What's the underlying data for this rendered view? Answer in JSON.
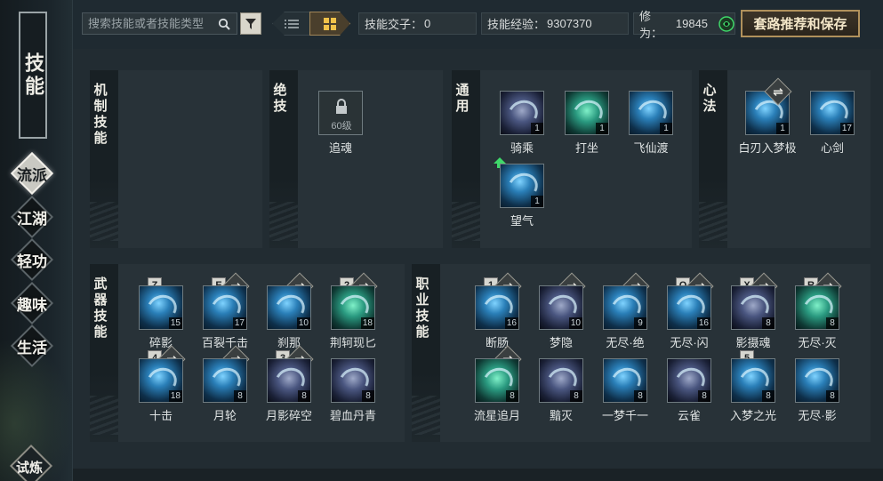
{
  "sidebar": {
    "title": "技能",
    "items": [
      {
        "label": "流派",
        "active": true
      },
      {
        "label": "江湖",
        "active": false
      },
      {
        "label": "轻功",
        "active": false
      },
      {
        "label": "趣味",
        "active": false
      },
      {
        "label": "生活",
        "active": false
      }
    ],
    "trial_label": "试炼"
  },
  "toolbar": {
    "search_placeholder": "搜索技能或者技能类型",
    "search_icon": "search-icon",
    "filter_icon": "filter-icon",
    "view_modes": [
      "list",
      "grid"
    ],
    "active_view": "grid",
    "stats": [
      {
        "label": "技能交子：",
        "value": "0"
      },
      {
        "label": "技能经验：",
        "value": "9307370"
      },
      {
        "label": "修为：",
        "value": "19845"
      }
    ],
    "recommend_label": "套路推荐和保存"
  },
  "panels": {
    "mechanism": {
      "title": "机制技能"
    },
    "ultimate": {
      "title": "绝技",
      "skills": [
        {
          "name": "追魂",
          "locked": true,
          "lock_text": "60级"
        }
      ]
    },
    "general": {
      "title": "通用",
      "skills": [
        {
          "name": "骑乘",
          "level": "1"
        },
        {
          "name": "打坐",
          "level": "1"
        },
        {
          "name": "飞仙渡",
          "level": "1"
        },
        {
          "name": "望气",
          "level": "1",
          "upgrade": true
        }
      ]
    },
    "mind": {
      "title": "心法",
      "skills": [
        {
          "name": "白刃入梦极",
          "level": "1",
          "swap": true
        },
        {
          "name": "心剑",
          "level": "17"
        }
      ]
    },
    "weapon": {
      "title": "武器技能",
      "skills": [
        {
          "name": "碎影",
          "level": "15",
          "key": "Z"
        },
        {
          "name": "百裂千击",
          "level": "17",
          "key": "E",
          "swap": true
        },
        {
          "name": "刹那",
          "level": "10",
          "swap": true
        },
        {
          "name": "荆轲现匕",
          "level": "18",
          "key": "2",
          "swap": true
        },
        {
          "name": "十击",
          "level": "18",
          "key": "4",
          "swap": true
        },
        {
          "name": "月轮",
          "level": "8",
          "swap": true
        },
        {
          "name": "月影碎空",
          "level": "8",
          "key": "3",
          "swap": true
        },
        {
          "name": "碧血丹青",
          "level": "8"
        }
      ]
    },
    "career": {
      "title": "职业技能",
      "skills": [
        {
          "name": "断肠",
          "level": "16",
          "key": "1",
          "swap": true
        },
        {
          "name": "梦隐",
          "level": "10",
          "swap": true
        },
        {
          "name": "无尽·绝",
          "level": "9",
          "swap": true
        },
        {
          "name": "无尽·闪",
          "level": "16",
          "key": "Q",
          "swap": true
        },
        {
          "name": "影摄魂",
          "level": "8",
          "key": "X",
          "swap": true
        },
        {
          "name": "无尽·灭",
          "level": "8",
          "key": "R",
          "swap": true
        },
        {
          "name": "流星追月",
          "level": "8",
          "swap": true
        },
        {
          "name": "黯灭",
          "level": "8"
        },
        {
          "name": "一梦千一",
          "level": "8"
        },
        {
          "name": "云雀",
          "level": "8"
        },
        {
          "name": "入梦之光",
          "level": "8",
          "key": "5"
        },
        {
          "name": "无尽·影",
          "level": "8"
        }
      ]
    }
  },
  "colors": {
    "accent_gold": "#b0915c",
    "panel_bg": "#283238",
    "upgrade_green": "#3fd86a"
  }
}
